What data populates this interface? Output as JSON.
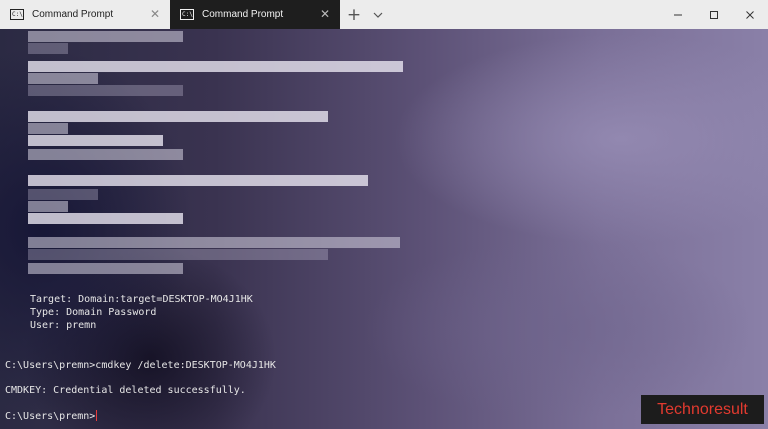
{
  "tabs": [
    {
      "label": "Command Prompt",
      "active": false,
      "icon": "cmd-icon"
    },
    {
      "label": "Command Prompt",
      "active": true,
      "icon": "cmd-icon"
    }
  ],
  "tab_icon_text": "C:\\",
  "controls": {
    "new_tab": "+",
    "dropdown": "chevron-down-icon",
    "minimize": "minimize-icon",
    "maximize": "maximize-icon",
    "close": "close-icon"
  },
  "terminal": {
    "credential": {
      "target": "Target: Domain:target=DESKTOP-MO4J1HK",
      "type": "Type: Domain Password",
      "user": "User: premn"
    },
    "command_line": "C:\\Users\\premn>cmdkey /delete:DESKTOP-MO4J1HK",
    "result_line": "CMDKEY: Credential deleted successfully.",
    "prompt_line": "C:\\Users\\premn>"
  },
  "watermark": "Technoresult",
  "colors": {
    "active_tab": "#1e1e1e",
    "tabbar": "#ececec",
    "cursor": "#e63b3b",
    "watermark_text": "#e23a2f"
  }
}
